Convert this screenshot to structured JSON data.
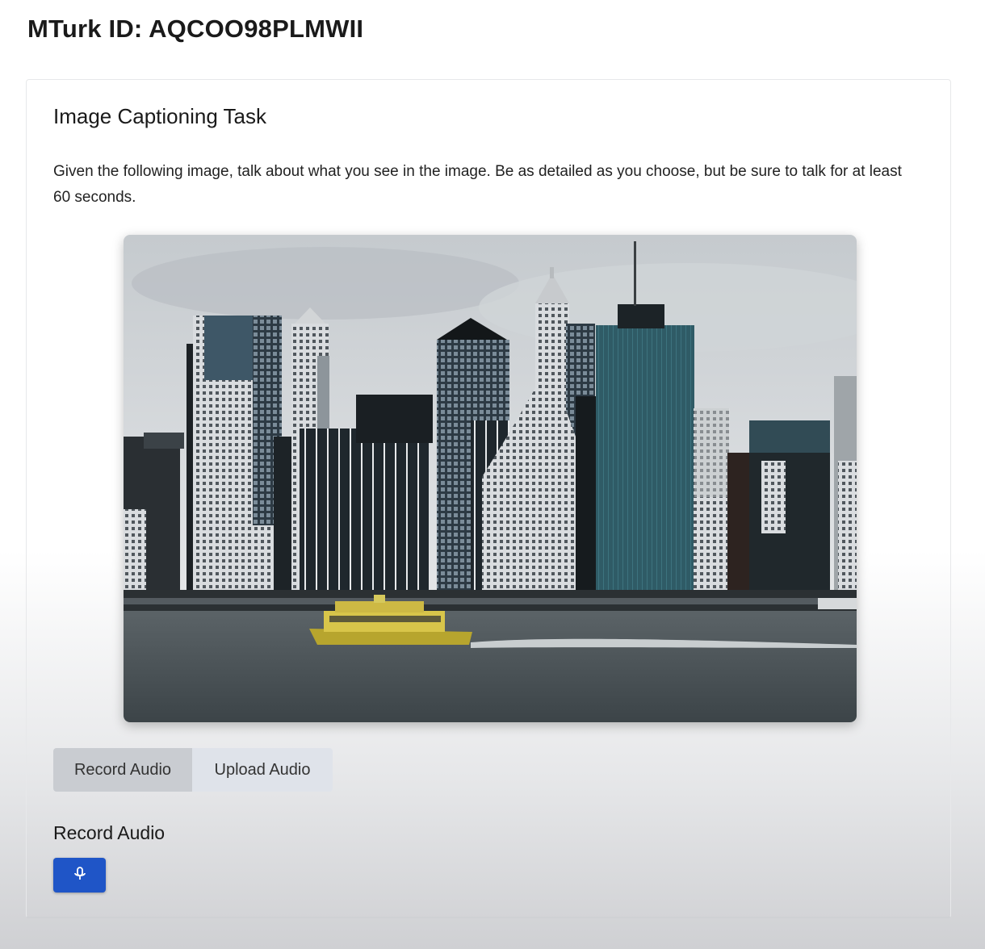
{
  "header": {
    "mturk_id_label": "MTurk ID: AQCOO98PLMWII"
  },
  "task": {
    "title": "Image Captioning Task",
    "instructions": "Given the following image, talk about what you see in the image. Be as detailed as you choose, but be sure to talk for at least 60 seconds.",
    "image_icon": "city-skyline-photo"
  },
  "audio_modes": {
    "tabs": [
      {
        "label": "Record Audio",
        "active": true
      },
      {
        "label": "Upload Audio",
        "active": false
      }
    ]
  },
  "record_section": {
    "heading": "Record Audio",
    "mic_icon": "microphone-icon"
  },
  "colors": {
    "accent": "#1f55c7",
    "active_tab": "#c9ccd1",
    "inactive_tab": "#dfe3ea"
  }
}
